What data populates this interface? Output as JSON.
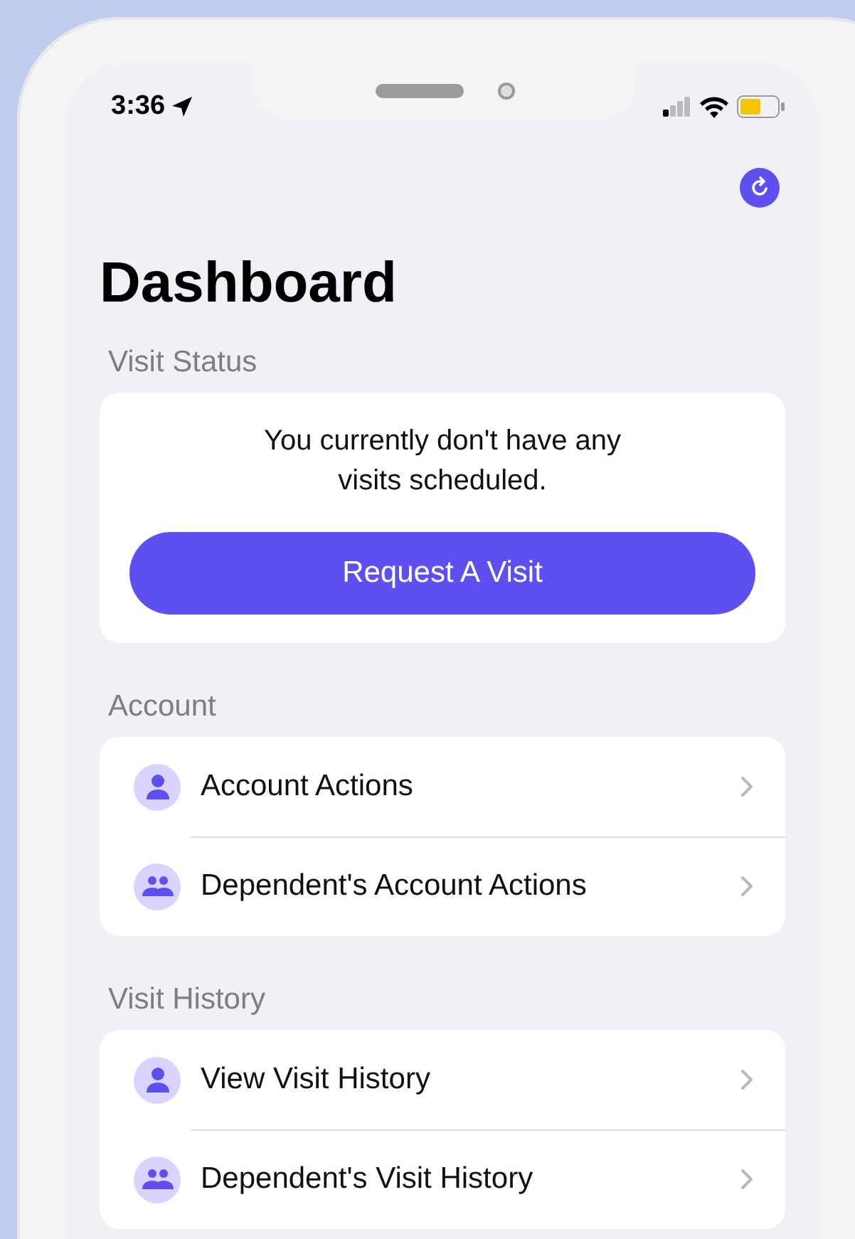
{
  "status_bar": {
    "time": "3:36",
    "location_on": true
  },
  "header": {
    "title": "Dashboard"
  },
  "visit_status": {
    "heading": "Visit Status",
    "message": "You currently don't have any visits scheduled.",
    "button": "Request A Visit"
  },
  "sections": [
    {
      "heading": "Account",
      "items": [
        {
          "label": "Account Actions",
          "kind": "person"
        },
        {
          "label": "Dependent's Account Actions",
          "kind": "group"
        }
      ]
    },
    {
      "heading": "Visit History",
      "items": [
        {
          "label": "View Visit History",
          "kind": "person"
        },
        {
          "label": "Dependent's Visit History",
          "kind": "group"
        }
      ]
    }
  ]
}
